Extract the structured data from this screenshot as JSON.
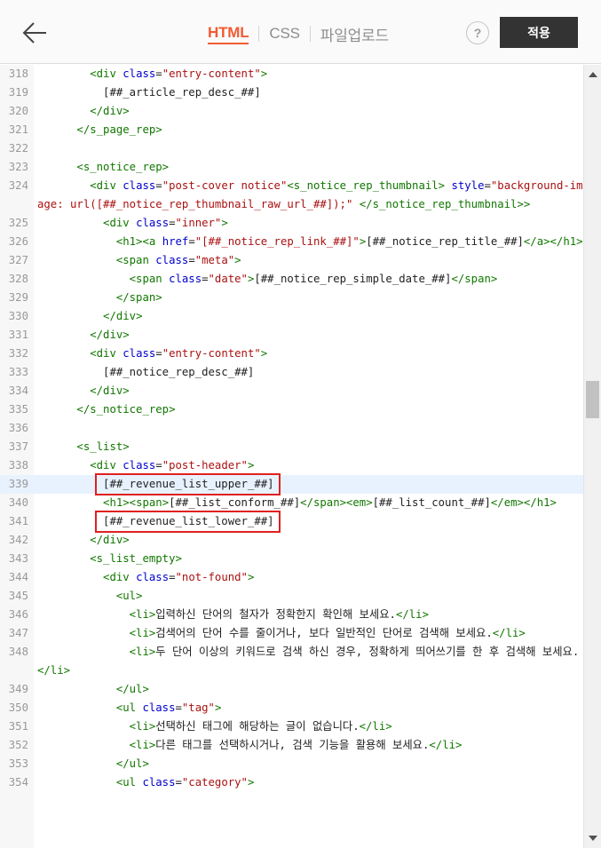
{
  "toolbar": {
    "back_icon": "arrow-left-icon",
    "tabs": [
      {
        "label": "HTML",
        "active": true
      },
      {
        "label": "CSS",
        "active": false
      },
      {
        "label": "파일업로드",
        "active": false
      }
    ],
    "help_label": "?",
    "apply_label": "적용"
  },
  "colors": {
    "accent": "#f25a32",
    "apply_button": "#333333",
    "tag": "#117700",
    "attribute": "#0000cc",
    "string": "#aa1111",
    "highlight_box": "#e02020",
    "active_line": "#e8f2ff"
  },
  "editor": {
    "highlighted_line": 339,
    "boxed_lines": [
      339,
      341
    ],
    "lines": [
      {
        "n": 318,
        "indent": 8,
        "tokens": [
          [
            "t",
            "<div"
          ],
          [
            "p",
            " "
          ],
          [
            "a",
            "class"
          ],
          [
            "p",
            "="
          ],
          [
            "s",
            "\"entry-content\""
          ],
          [
            "t",
            ">"
          ]
        ]
      },
      {
        "n": 319,
        "indent": 10,
        "tokens": [
          [
            "p",
            "[##_article_rep_desc_##]"
          ]
        ]
      },
      {
        "n": 320,
        "indent": 8,
        "tokens": [
          [
            "t",
            "</div>"
          ]
        ]
      },
      {
        "n": 321,
        "indent": 6,
        "tokens": [
          [
            "t",
            "</s_page_rep>"
          ]
        ]
      },
      {
        "n": 322,
        "indent": 0,
        "tokens": []
      },
      {
        "n": 323,
        "indent": 6,
        "tokens": [
          [
            "t",
            "<s_notice_rep>"
          ]
        ]
      },
      {
        "n": 324,
        "indent": 8,
        "tokens": [
          [
            "t",
            "<div"
          ],
          [
            "p",
            " "
          ],
          [
            "a",
            "class"
          ],
          [
            "p",
            "="
          ],
          [
            "s",
            "\"post-cover notice\""
          ],
          [
            "t",
            "<s_notice_rep_thumbnail>"
          ],
          [
            "p",
            " "
          ],
          [
            "a",
            "style"
          ],
          [
            "p",
            "="
          ],
          [
            "s",
            "\"background-image: url([##_notice_rep_thumbnail_raw_url_##]);\""
          ],
          [
            "p",
            " "
          ],
          [
            "t",
            "</s_notice_rep_thumbnail>"
          ],
          [
            "t",
            ">"
          ]
        ]
      },
      {
        "n": 325,
        "indent": 10,
        "tokens": [
          [
            "t",
            "<div"
          ],
          [
            "p",
            " "
          ],
          [
            "a",
            "class"
          ],
          [
            "p",
            "="
          ],
          [
            "s",
            "\"inner\""
          ],
          [
            "t",
            ">"
          ]
        ]
      },
      {
        "n": 326,
        "indent": 12,
        "tokens": [
          [
            "t",
            "<h1>"
          ],
          [
            "t",
            "<a"
          ],
          [
            "p",
            " "
          ],
          [
            "a",
            "href"
          ],
          [
            "p",
            "="
          ],
          [
            "s",
            "\"[##_notice_rep_link_##]\""
          ],
          [
            "t",
            ">"
          ],
          [
            "p",
            "[##_notice_rep_title_##]"
          ],
          [
            "t",
            "</a>"
          ],
          [
            "t",
            "</h1>"
          ]
        ]
      },
      {
        "n": 327,
        "indent": 12,
        "tokens": [
          [
            "t",
            "<span"
          ],
          [
            "p",
            " "
          ],
          [
            "a",
            "class"
          ],
          [
            "p",
            "="
          ],
          [
            "s",
            "\"meta\""
          ],
          [
            "t",
            ">"
          ]
        ]
      },
      {
        "n": 328,
        "indent": 14,
        "tokens": [
          [
            "t",
            "<span"
          ],
          [
            "p",
            " "
          ],
          [
            "a",
            "class"
          ],
          [
            "p",
            "="
          ],
          [
            "s",
            "\"date\""
          ],
          [
            "t",
            ">"
          ],
          [
            "p",
            "[##_notice_rep_simple_date_##]"
          ],
          [
            "t",
            "</span>"
          ]
        ]
      },
      {
        "n": 329,
        "indent": 12,
        "tokens": [
          [
            "t",
            "</span>"
          ]
        ]
      },
      {
        "n": 330,
        "indent": 10,
        "tokens": [
          [
            "t",
            "</div>"
          ]
        ]
      },
      {
        "n": 331,
        "indent": 8,
        "tokens": [
          [
            "t",
            "</div>"
          ]
        ]
      },
      {
        "n": 332,
        "indent": 8,
        "tokens": [
          [
            "t",
            "<div"
          ],
          [
            "p",
            " "
          ],
          [
            "a",
            "class"
          ],
          [
            "p",
            "="
          ],
          [
            "s",
            "\"entry-content\""
          ],
          [
            "t",
            ">"
          ]
        ]
      },
      {
        "n": 333,
        "indent": 10,
        "tokens": [
          [
            "p",
            "[##_notice_rep_desc_##]"
          ]
        ]
      },
      {
        "n": 334,
        "indent": 8,
        "tokens": [
          [
            "t",
            "</div>"
          ]
        ]
      },
      {
        "n": 335,
        "indent": 6,
        "tokens": [
          [
            "t",
            "</s_notice_rep>"
          ]
        ]
      },
      {
        "n": 336,
        "indent": 0,
        "tokens": []
      },
      {
        "n": 337,
        "indent": 6,
        "tokens": [
          [
            "t",
            "<s_list>"
          ]
        ]
      },
      {
        "n": 338,
        "indent": 8,
        "tokens": [
          [
            "t",
            "<div"
          ],
          [
            "p",
            " "
          ],
          [
            "a",
            "class"
          ],
          [
            "p",
            "="
          ],
          [
            "s",
            "\"post-header\""
          ],
          [
            "t",
            ">"
          ]
        ]
      },
      {
        "n": 339,
        "indent": 10,
        "tokens": [
          [
            "p",
            "[##_revenue_list_upper_##]"
          ]
        ]
      },
      {
        "n": 340,
        "indent": 10,
        "tokens": [
          [
            "t",
            "<h1>"
          ],
          [
            "t",
            "<span>"
          ],
          [
            "p",
            "[##_list_conform_##]"
          ],
          [
            "t",
            "</span>"
          ],
          [
            "t",
            "<em>"
          ],
          [
            "p",
            "[##_list_count_##]"
          ],
          [
            "t",
            "</em>"
          ],
          [
            "t",
            "</h1>"
          ]
        ]
      },
      {
        "n": 341,
        "indent": 10,
        "tokens": [
          [
            "p",
            "[##_revenue_list_lower_##]"
          ]
        ]
      },
      {
        "n": 342,
        "indent": 8,
        "tokens": [
          [
            "t",
            "</div>"
          ]
        ]
      },
      {
        "n": 343,
        "indent": 8,
        "tokens": [
          [
            "t",
            "<s_list_empty>"
          ]
        ]
      },
      {
        "n": 344,
        "indent": 10,
        "tokens": [
          [
            "t",
            "<div"
          ],
          [
            "p",
            " "
          ],
          [
            "a",
            "class"
          ],
          [
            "p",
            "="
          ],
          [
            "s",
            "\"not-found\""
          ],
          [
            "t",
            ">"
          ]
        ]
      },
      {
        "n": 345,
        "indent": 12,
        "tokens": [
          [
            "t",
            "<ul>"
          ]
        ]
      },
      {
        "n": 346,
        "indent": 14,
        "tokens": [
          [
            "t",
            "<li>"
          ],
          [
            "p",
            "입력하신 단어의 철자가 정확한지 확인해 보세요."
          ],
          [
            "t",
            "</li>"
          ]
        ]
      },
      {
        "n": 347,
        "indent": 14,
        "tokens": [
          [
            "t",
            "<li>"
          ],
          [
            "p",
            "검색어의 단어 수를 줄이거나, 보다 일반적인 단어로 검색해 보세요."
          ],
          [
            "t",
            "</li>"
          ]
        ]
      },
      {
        "n": 348,
        "indent": 14,
        "tokens": [
          [
            "t",
            "<li>"
          ],
          [
            "p",
            "두 단어 이상의 키워드로 검색 하신 경우, 정확하게 띄어쓰기를 한 후 검색해 보세요."
          ],
          [
            "t",
            "</li>"
          ]
        ]
      },
      {
        "n": 349,
        "indent": 12,
        "tokens": [
          [
            "t",
            "</ul>"
          ]
        ]
      },
      {
        "n": 350,
        "indent": 12,
        "tokens": [
          [
            "t",
            "<ul"
          ],
          [
            "p",
            " "
          ],
          [
            "a",
            "class"
          ],
          [
            "p",
            "="
          ],
          [
            "s",
            "\"tag\""
          ],
          [
            "t",
            ">"
          ]
        ]
      },
      {
        "n": 351,
        "indent": 14,
        "tokens": [
          [
            "t",
            "<li>"
          ],
          [
            "p",
            "선택하신 태그에 해당하는 글이 없습니다."
          ],
          [
            "t",
            "</li>"
          ]
        ]
      },
      {
        "n": 352,
        "indent": 14,
        "tokens": [
          [
            "t",
            "<li>"
          ],
          [
            "p",
            "다른 태그를 선택하시거나, 검색 기능을 활용해 보세요."
          ],
          [
            "t",
            "</li>"
          ]
        ]
      },
      {
        "n": 353,
        "indent": 12,
        "tokens": [
          [
            "t",
            "</ul>"
          ]
        ]
      },
      {
        "n": 354,
        "indent": 12,
        "tokens": [
          [
            "t",
            "<ul"
          ],
          [
            "p",
            " "
          ],
          [
            "a",
            "class"
          ],
          [
            "p",
            "="
          ],
          [
            "s",
            "\"category\""
          ],
          [
            "t",
            ">"
          ]
        ]
      }
    ]
  },
  "scrollbar": {
    "up_icon": "scroll-up-arrow-icon",
    "down_icon": "scroll-down-arrow-icon",
    "position_fraction": 0.42
  }
}
